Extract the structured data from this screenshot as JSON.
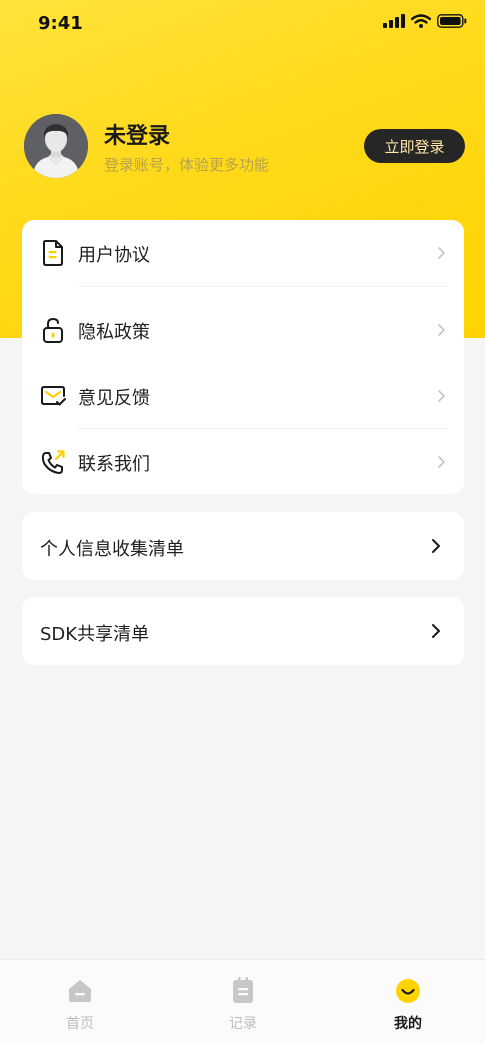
{
  "status_bar": {
    "time": "9:41"
  },
  "profile": {
    "name": "未登录",
    "subtitle": "登录账号，体验更多功能",
    "login_button": "立即登录"
  },
  "menu": {
    "items": [
      {
        "label": "用户协议",
        "icon": "document-icon"
      },
      {
        "label": "隐私政策",
        "icon": "unlock-icon"
      },
      {
        "label": "意见反馈",
        "icon": "mail-feedback-icon"
      },
      {
        "label": "联系我们",
        "icon": "phone-icon"
      }
    ]
  },
  "lists": {
    "personal_info": "个人信息收集清单",
    "sdk_share": "SDK共享清单"
  },
  "tabbar": {
    "tabs": [
      {
        "label": "首页",
        "icon": "home-icon",
        "active": false
      },
      {
        "label": "记录",
        "icon": "record-icon",
        "active": false
      },
      {
        "label": "我的",
        "icon": "smile-icon",
        "active": true
      }
    ]
  },
  "colors": {
    "accent_yellow": "#ffd91a",
    "button_dark": "#262626",
    "button_text": "#ffe7a6",
    "tab_inactive": "#bdbdbd"
  }
}
